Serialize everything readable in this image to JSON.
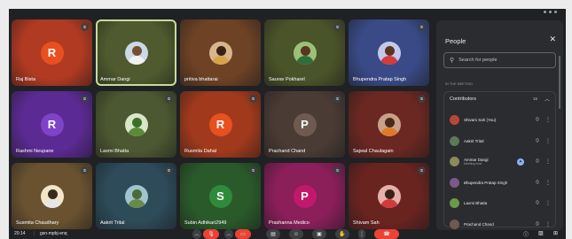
{
  "participants": [
    {
      "name": "Raj Bista",
      "letter": "R",
      "bg": "#b13a22",
      "avatar_bg": "#e8501f",
      "mic_off": true
    },
    {
      "name": "Ammar Dangi",
      "photo": true,
      "bg": "#4f5a2e",
      "head": "#7a4c30",
      "body": "#f1f1f1",
      "sky": "#c8d9e8",
      "active": true,
      "mic_off": false
    },
    {
      "name": "pritiva bhattarai",
      "photo": true,
      "bg": "#6d4225",
      "head": "#3a2216",
      "body": "#d7a34a",
      "sky": "#d8b58c",
      "mic_off": false
    },
    {
      "name": "Saurav Pokharel",
      "photo": true,
      "bg": "#4a5429",
      "head": "#5a3520",
      "body": "#2f6f3b",
      "sky": "#9cc07a",
      "mic_off": true
    },
    {
      "name": "Bhupendra Pratap Singh",
      "photo": true,
      "bg": "#3a4a86",
      "head": "#5b3421",
      "body": "#d63a3a",
      "sky": "#c2c9e9",
      "mic_off": true
    },
    {
      "name": "Rashmi Neupane",
      "letter": "R",
      "bg": "#5c2a93",
      "avatar_bg": "#7f43c7",
      "mic_off": true
    },
    {
      "name": "Laxmi Bhatta",
      "photo": true,
      "bg": "#4c5831",
      "head": "#3a6f2a",
      "body": "#5b8a3a",
      "sky": "#d8e6c8",
      "mic_off": true
    },
    {
      "name": "Rusmita Dahal",
      "letter": "R",
      "bg": "#a13a1c",
      "avatar_bg": "#e8501f",
      "mic_off": true
    },
    {
      "name": "Prachand Chand",
      "letter": "P",
      "bg": "#4a3b34",
      "avatar_bg": "#6e5a50",
      "mic_off": true
    },
    {
      "name": "Sajwal Chaulagain",
      "photo": true,
      "bg": "#6b2822",
      "head": "#4a2a1a",
      "body": "#e07a28",
      "sky": "#c9a18a",
      "mic_off": true
    },
    {
      "name": "Susmita Chaudhary",
      "photo": true,
      "bg": "#6a5230",
      "head": "#3a2a1e",
      "body": "#e6e6e6",
      "sky": "#f2e6c8",
      "mic_off": true
    },
    {
      "name": "Aakrit Trital",
      "photo": true,
      "bg": "#2d4b58",
      "head": "#4a6a3a",
      "body": "#6a8a4a",
      "sky": "#9fc3cf",
      "mic_off": true
    },
    {
      "name": "Subin Adhikari2949",
      "letter": "S",
      "bg": "#2b5a2a",
      "avatar_bg": "#2e8b3a",
      "mic_off": true
    },
    {
      "name": "Prashanna Medico",
      "letter": "P",
      "bg": "#8a1f5a",
      "avatar_bg": "#c2186b",
      "mic_off": true
    },
    {
      "name": "Shivam Sah",
      "photo": true,
      "bg": "#6a2420",
      "head": "#3a2216",
      "body": "#d03a3a",
      "sky": "#e6b0a8",
      "mic_off": true
    }
  ],
  "panel": {
    "title": "People",
    "search_placeholder": "Search for people",
    "section_label": "IN THE MEETING",
    "contributors_label": "Contributors",
    "contributors_count": "15",
    "list": [
      {
        "name": "Shivam Sah (You)",
        "sub": "",
        "avatar": "#b8463a",
        "host": false
      },
      {
        "name": "Aakrit Trital",
        "sub": "",
        "avatar": "#5a7a5a",
        "host": false
      },
      {
        "name": "Ammar Dangi",
        "sub": "Meeting host",
        "avatar": "#8a8a5a",
        "host": true
      },
      {
        "name": "Bhupendra Pratap Singh",
        "sub": "",
        "avatar": "#7a5a8a",
        "host": false
      },
      {
        "name": "Laxmi Bhatta",
        "sub": "",
        "avatar": "#6a9a4a",
        "host": false
      },
      {
        "name": "Prachand Chand",
        "sub": "",
        "avatar": "#6e5a50",
        "host": false
      }
    ]
  },
  "bottom": {
    "time": "20:14",
    "separator": "|",
    "code": "gsn-mpbj-enq"
  }
}
